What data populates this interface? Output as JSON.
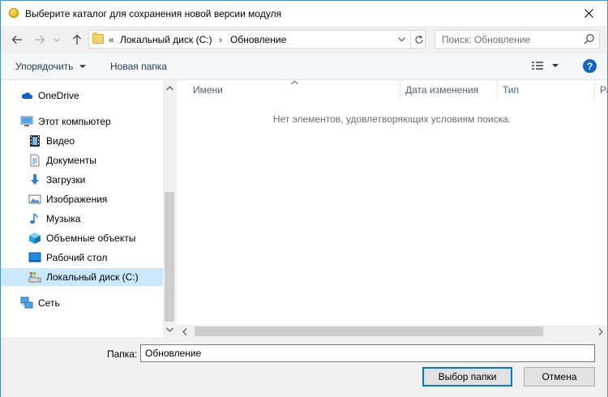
{
  "window": {
    "title": "Выберите каталог для сохранения новой версии модуля"
  },
  "address": {
    "prefix": "«",
    "crumbs": [
      "Локальный диск (C:)",
      "Обновление"
    ],
    "separator": "›"
  },
  "search": {
    "placeholder": "Поиск: Обновление"
  },
  "toolbar": {
    "organize_label": "Упорядочить",
    "new_folder_label": "Новая папка",
    "help_label": "?"
  },
  "nav": {
    "items": [
      {
        "label": "OneDrive",
        "icon": "cloud-icon"
      },
      {
        "label": "Этот компьютер",
        "icon": "computer-icon"
      },
      {
        "label": "Видео",
        "icon": "video-icon"
      },
      {
        "label": "Документы",
        "icon": "documents-icon"
      },
      {
        "label": "Загрузки",
        "icon": "download-icon"
      },
      {
        "label": "Изображения",
        "icon": "pictures-icon"
      },
      {
        "label": "Музыка",
        "icon": "music-icon"
      },
      {
        "label": "Объемные объекты",
        "icon": "3d-objects-icon"
      },
      {
        "label": "Рабочий стол",
        "icon": "desktop-icon"
      },
      {
        "label": "Локальный диск (C:)",
        "icon": "drive-icon"
      },
      {
        "label": "Сеть",
        "icon": "network-icon"
      }
    ],
    "selected": "Локальный диск (C:)"
  },
  "columns": {
    "name": "Имени",
    "date": "Дата изменения",
    "type": "Тип",
    "size": "Ра"
  },
  "content": {
    "empty_message": "Нет элементов, удовлетворяющих условиям поиска."
  },
  "footer": {
    "folder_label": "Папка:",
    "folder_value": "Обновление",
    "select_button": "Выбор папки",
    "cancel_button": "Отмена"
  },
  "colors": {
    "accent": "#0078d7",
    "selection": "#cce8ff",
    "link_text": "#1e395b"
  }
}
